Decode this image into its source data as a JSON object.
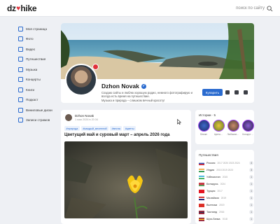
{
  "app": {
    "logo_left": "dz",
    "logo_right": "hike",
    "logo_heart": "♥"
  },
  "search": {
    "placeholder": "поиск по сайту",
    "icon": "search-icon"
  },
  "sidebar": {
    "items": [
      {
        "label": "Моя страница",
        "icon": "user-icon"
      },
      {
        "label": "Фото",
        "icon": "photo-icon"
      },
      {
        "label": "Видео",
        "icon": "video-icon"
      },
      {
        "label": "Путешествия",
        "icon": "globe-icon"
      },
      {
        "label": "Музыка",
        "icon": "music-icon"
      },
      {
        "label": "Концерты",
        "icon": "ticket-icon"
      },
      {
        "label": "Книги",
        "icon": "book-icon"
      },
      {
        "label": "Подкаст",
        "icon": "mic-icon"
      },
      {
        "label": "Виниловые диски",
        "icon": "disc-icon"
      },
      {
        "label": "Записи стримов",
        "icon": "stream-icon"
      }
    ]
  },
  "profile": {
    "name": "Dzhon Novak",
    "bio_1": "Создаю сайты и люблю хорошую радио, немного фотографирую и",
    "bio_2": "всегда есть время на путешествие.",
    "bio_3": "Музыка и природа – слишком вечный красоту!",
    "follow_label": "Купарить"
  },
  "post": {
    "author": "Dzhon Novak",
    "date": "1 мая 2026 в 20:34",
    "tags": [
      "#природа",
      "#каждый_весенний",
      "#весна",
      "#цветы"
    ],
    "title": "Цветущий май и суровый март – апрель 2026 года"
  },
  "stories": {
    "title": "Истории · 5",
    "items": [
      {
        "label": "Stream"
      },
      {
        "label": "Цвета…"
      },
      {
        "label": "Любимое…"
      },
      {
        "label": "Концерт…"
      }
    ]
  },
  "travels": {
    "title": "Путешествия",
    "countries": [
      {
        "name": "Россия",
        "years": "2017 2020 2023 2024",
        "count": "4",
        "flag": [
          "#ffffff",
          "#2a4fb5",
          "#d7262f"
        ]
      },
      {
        "name": "Индия",
        "years": "2015 2019 2023",
        "count": "3",
        "flag": [
          "#f39a2b",
          "#ffffff",
          "#138a3b"
        ]
      },
      {
        "name": "Узбекистан",
        "years": "2015",
        "count": "1",
        "flag": [
          "#1ea7d6",
          "#ffffff",
          "#2aa84a"
        ]
      },
      {
        "name": "Беларусь",
        "years": "2024",
        "count": "1",
        "flag": [
          "#c8313e",
          "#c8313e",
          "#4aa657"
        ]
      },
      {
        "name": "Турция",
        "years": "2017",
        "count": "1",
        "flag": [
          "#e30a17",
          "#e30a17",
          "#e30a17"
        ]
      },
      {
        "name": "Малайзия",
        "years": "2019",
        "count": "1",
        "flag": [
          "#cc0001",
          "#ffffff",
          "#010066"
        ]
      },
      {
        "name": "Вьетнам",
        "years": "2019",
        "count": "1",
        "flag": [
          "#da251d",
          "#da251d",
          "#da251d"
        ]
      },
      {
        "name": "Таиланд",
        "years": "2016",
        "count": "1",
        "flag": [
          "#a51931",
          "#2d2a4a",
          "#a51931"
        ]
      },
      {
        "name": "Шри-Ланка",
        "years": "2018",
        "count": "1",
        "flag": [
          "#8d153a",
          "#f9b724",
          "#8d153a"
        ]
      }
    ]
  },
  "colors": {
    "accent": "#2a6bcf",
    "brand_heart": "#e0313b",
    "story_ring": "#a64bf4"
  }
}
